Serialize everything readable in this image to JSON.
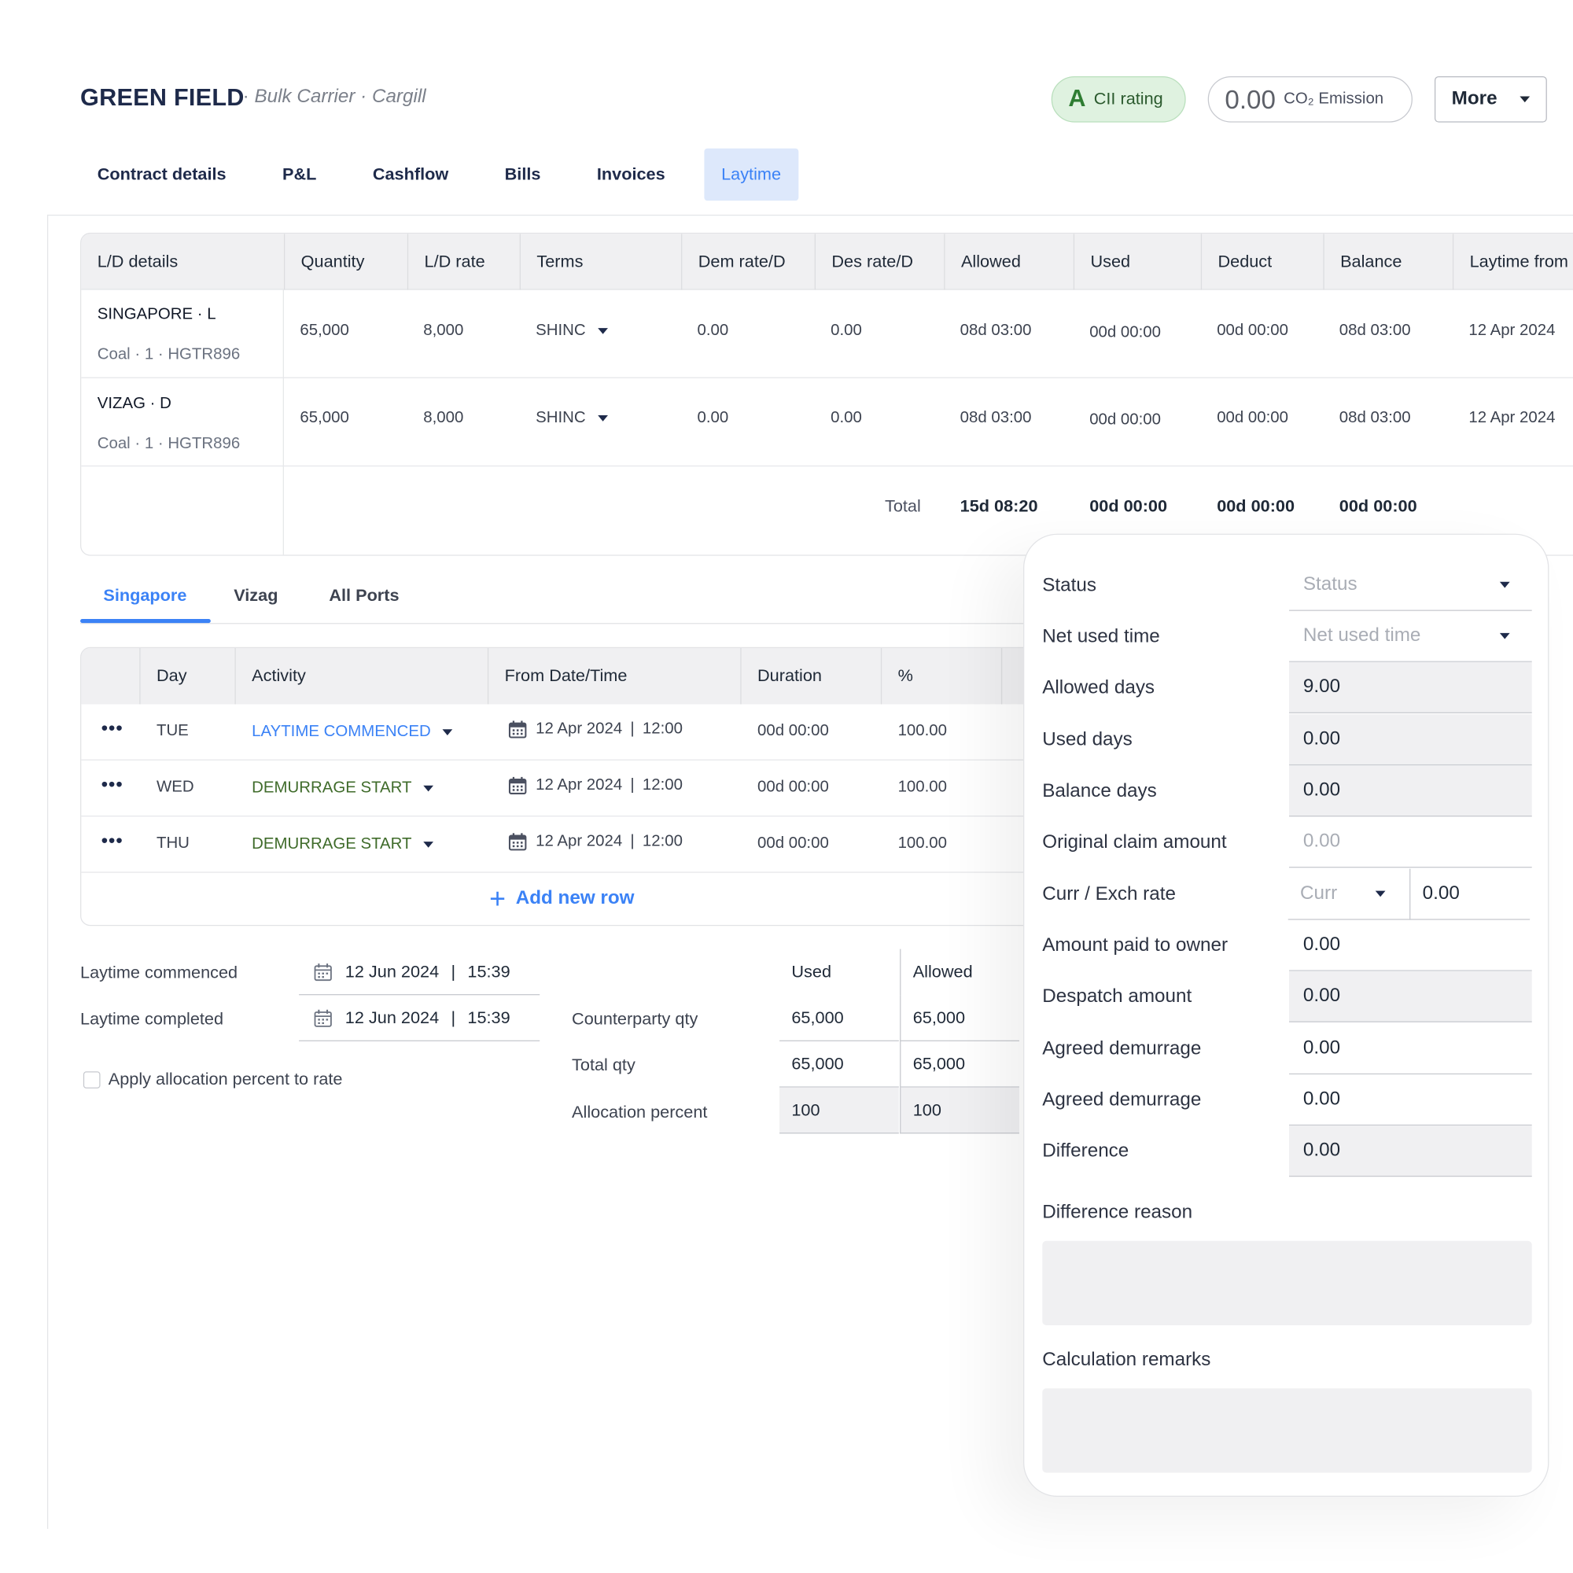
{
  "header": {
    "vessel_name": "GREEN FIELD",
    "separator": "·",
    "subtitle": "Bulk Carrier · Cargill",
    "cii_grade": "A",
    "cii_label": "CII rating",
    "co2_value": "0.00",
    "co2_label": "CO₂ Emission",
    "more_label": "More"
  },
  "tabs": [
    "Contract details",
    "P&L",
    "Cashflow",
    "Bills",
    "Invoices",
    "Laytime"
  ],
  "active_tab": "Laytime",
  "ld_table": {
    "headers": [
      "L/D details",
      "Quantity",
      "L/D rate",
      "Terms",
      "Dem rate/D",
      "Des rate/D",
      "Allowed",
      "Used",
      "Deduct",
      "Balance",
      "Laytime from"
    ],
    "rows": [
      {
        "port": "SINGAPORE · L",
        "cargo": "Coal · 1 · HGTR896",
        "quantity": "65,000",
        "ld_rate": "8,000",
        "terms": "SHINC",
        "dem_rate": "0.00",
        "des_rate": "0.00",
        "allowed": "08d 03:00",
        "used": "00d 00:00",
        "deduct": "00d 00:00",
        "balance": "08d 03:00",
        "laytime_from": "12 Apr 2024"
      },
      {
        "port": "VIZAG · D",
        "cargo": "Coal · 1 · HGTR896",
        "quantity": "65,000",
        "ld_rate": "8,000",
        "terms": "SHINC",
        "dem_rate": "0.00",
        "des_rate": "0.00",
        "allowed": "08d 03:00",
        "used": "00d 00:00",
        "deduct": "00d 00:00",
        "balance": "08d 03:00",
        "laytime_from": "12 Apr 2024"
      }
    ],
    "total_label": "Total",
    "total_allowed": "15d 08:20",
    "total_used": "00d 00:00",
    "total_deduct": "00d 00:00",
    "total_balance": "00d 00:00"
  },
  "port_tabs": [
    "Singapore",
    "Vizag",
    "All Ports"
  ],
  "active_port_tab": "Singapore",
  "activity_table": {
    "headers": [
      "Day",
      "Activity",
      "From Date/Time",
      "Duration",
      "%"
    ],
    "rows": [
      {
        "day": "TUE",
        "activity": "LAYTIME COMMENCED",
        "from_date": "12 Apr 2024",
        "from_time": "12:00",
        "duration": "00d 00:00",
        "percent": "100.00"
      },
      {
        "day": "WED",
        "activity": "DEMURRAGE START",
        "from_date": "12 Apr 2024",
        "from_time": "12:00",
        "duration": "00d 00:00",
        "percent": "100.00"
      },
      {
        "day": "THU",
        "activity": "DEMURRAGE START",
        "from_date": "12 Apr 2024",
        "from_time": "12:00",
        "duration": "00d 00:00",
        "percent": "100.00"
      }
    ],
    "add_row_label": "Add new row"
  },
  "laytime": {
    "commenced_label": "Laytime commenced",
    "commenced_date": "12 Jun 2024",
    "commenced_time": "15:39",
    "completed_label": "Laytime completed",
    "completed_date": "12 Jun 2024",
    "completed_time": "15:39",
    "apply_allocation_label": "Apply allocation percent to rate"
  },
  "quantities": {
    "used_header": "Used",
    "allowed_header": "Allowed",
    "rows": [
      {
        "label": "Counterparty qty",
        "used": "65,000",
        "allowed": "65,000"
      },
      {
        "label": "Total qty",
        "used": "65,000",
        "allowed": "65,000"
      },
      {
        "label": "Allocation percent",
        "used": "100",
        "allowed": "100"
      }
    ]
  },
  "side_form": {
    "status_label": "Status",
    "status_placeholder": "Status",
    "net_used_label": "Net used time",
    "net_used_placeholder": "Net used time",
    "allowed_days_label": "Allowed days",
    "allowed_days": "9.00",
    "used_days_label": "Used days",
    "used_days": "0.00",
    "balance_days_label": "Balance days",
    "balance_days": "0.00",
    "original_claim_label": "Original claim amount",
    "original_claim_placeholder": "0.00",
    "curr_exch_label": "Curr / Exch rate",
    "curr_placeholder": "Curr",
    "exch_rate": "0.00",
    "amount_paid_label": "Amount paid to owner",
    "amount_paid": "0.00",
    "despatch_label": "Despatch amount",
    "despatch": "0.00",
    "agreed_dem_label_1": "Agreed demurrage",
    "agreed_dem_1": "0.00",
    "agreed_dem_label_2": "Agreed demurrage",
    "agreed_dem_2": "0.00",
    "difference_label": "Difference",
    "difference": "0.00",
    "difference_reason_label": "Difference reason",
    "calc_remarks_label": "Calculation remarks"
  },
  "colors": {
    "accent": "#3b82f6",
    "cii_green": "#2e7d32",
    "activity_green": "#3f6b2a"
  }
}
